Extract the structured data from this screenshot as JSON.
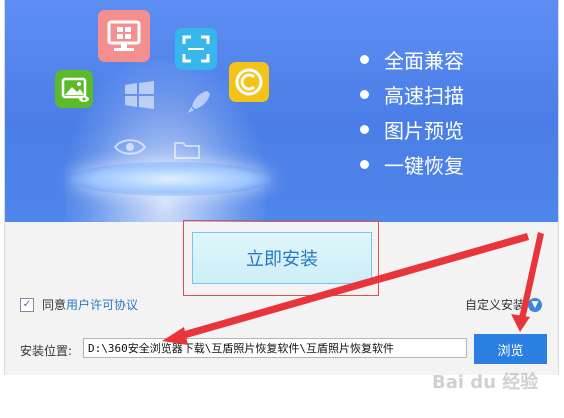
{
  "hero": {
    "features": [
      {
        "label": "全面兼容"
      },
      {
        "label": "高速扫描"
      },
      {
        "label": "图片预览"
      },
      {
        "label": "一键恢复"
      }
    ],
    "tile_colors": {
      "monitor": "#f58f8f",
      "scan": "#36b6ea",
      "copyright": "#f4c318",
      "image": "#5cba2a"
    }
  },
  "install": {
    "button_label": "立即安装"
  },
  "agreement": {
    "checked": "✓",
    "prefix": "同意",
    "link": "用户许可协议"
  },
  "custom_install": {
    "label": "自定义安装"
  },
  "location": {
    "label": "安装位置:",
    "path": "D:\\360安全浏览器下载\\互盾照片恢复软件\\互盾照片恢复软件"
  },
  "browse": {
    "label": "浏览"
  },
  "watermark": {
    "text": "Bai du 经验"
  },
  "colors": {
    "accent": "#2a7fe0",
    "highlight_border": "#e05050",
    "arrow": "#e8343a"
  }
}
